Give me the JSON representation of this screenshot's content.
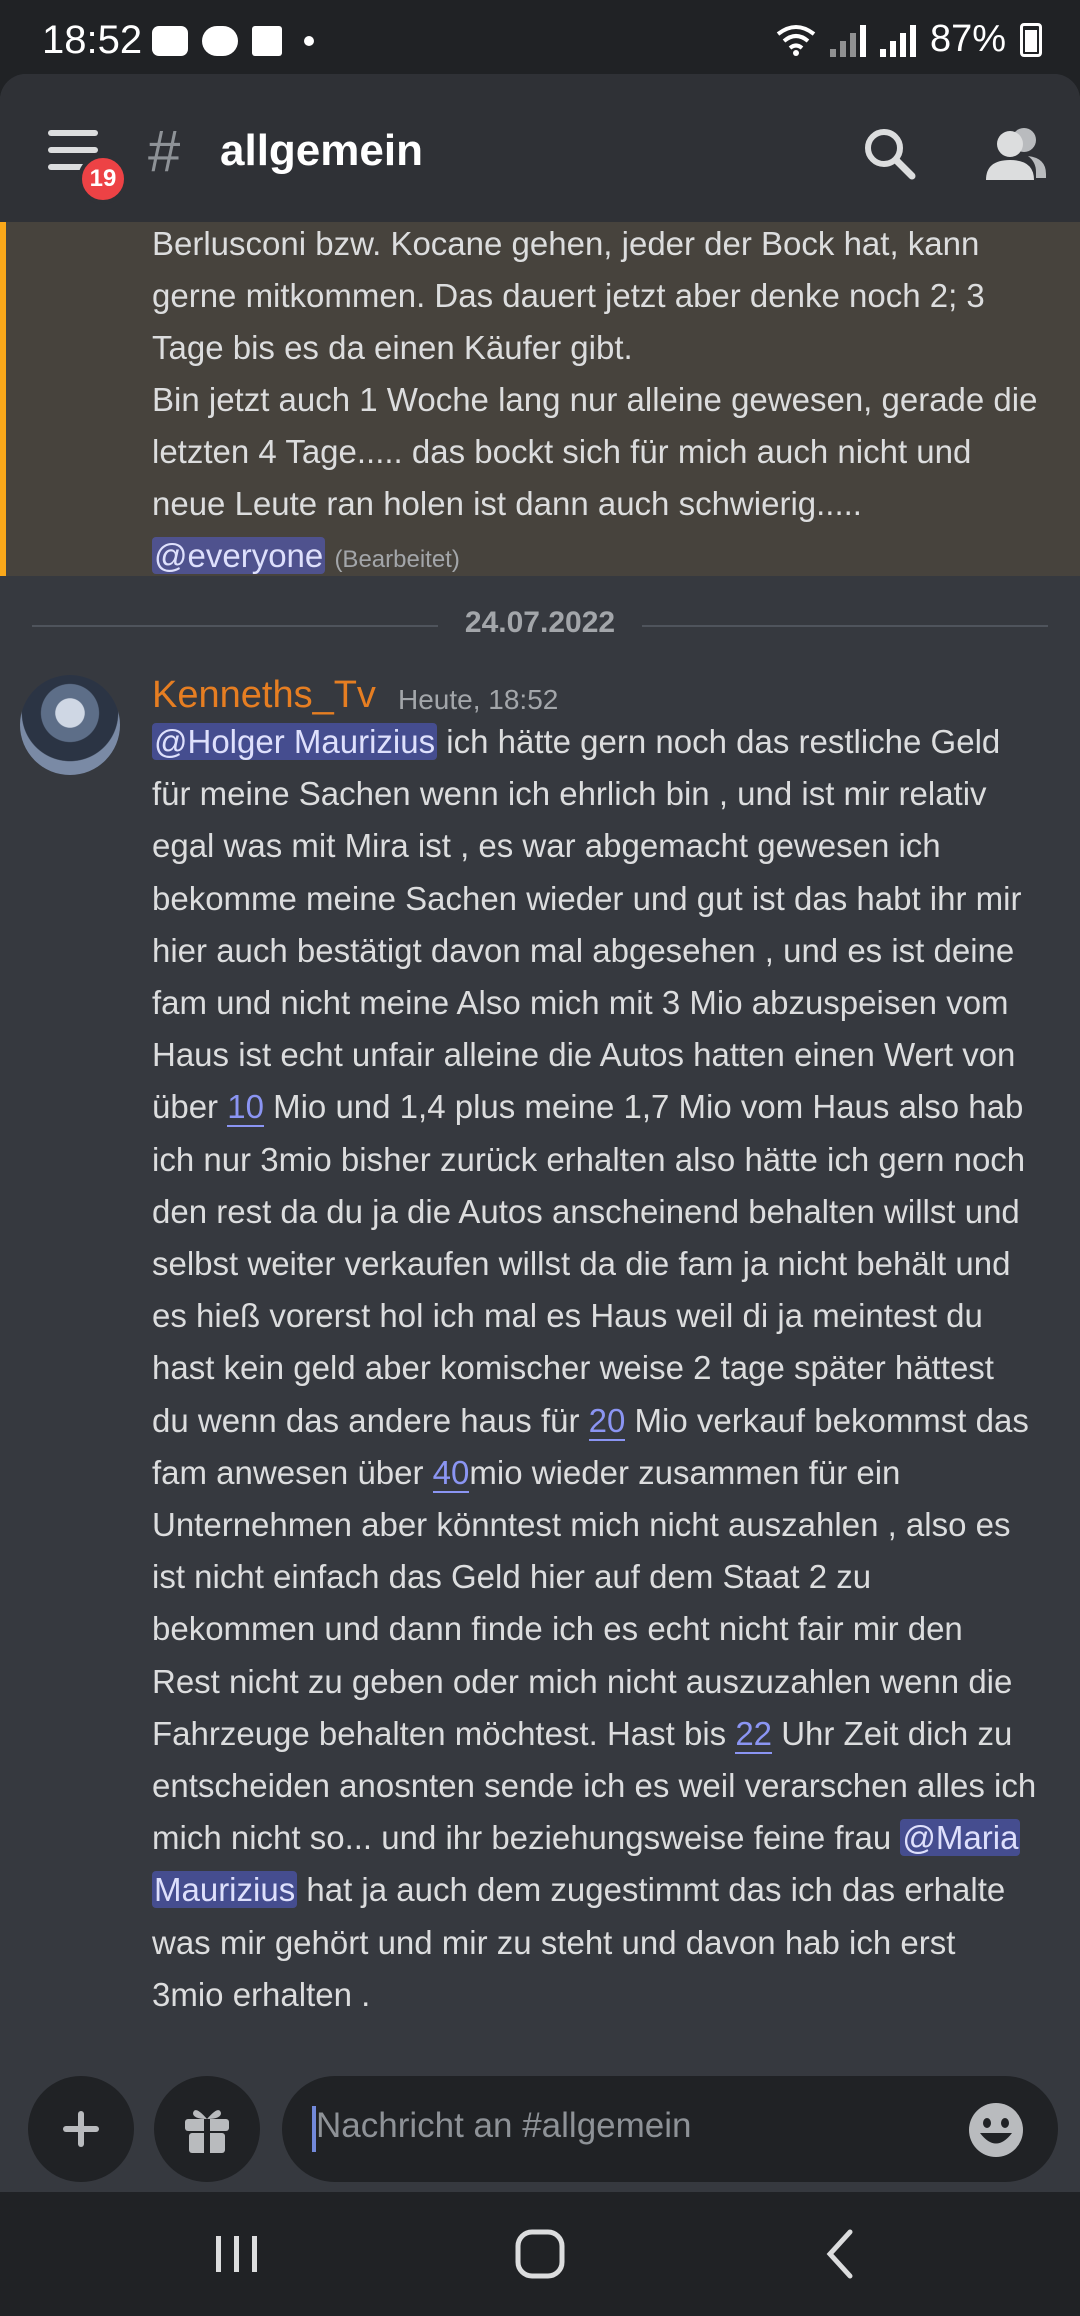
{
  "status_bar": {
    "time": "18:52",
    "battery": "87%",
    "icons_left": [
      "youtube-icon",
      "cloud-icon",
      "twitch-icon"
    ]
  },
  "header": {
    "hash": "#",
    "channel": "allgemein",
    "unread_badge": "19"
  },
  "previous_message": {
    "lines": [
      "Berlusconi bzw. Kocane gehen, jeder der Bock hat, kann",
      "gerne mitkommen. Das dauert jetzt aber denke noch 2; 3",
      "Tage bis es da einen Käufer gibt.",
      "Bin jetzt auch 1 Woche lang nur alleine gewesen, gerade die",
      "letzten 4 Tage..... das bockt sich für mich auch nicht und",
      "neue Leute ran holen ist dann auch schwierig....."
    ],
    "mention": "@everyone",
    "edited": "(Bearbeitet)"
  },
  "divider_date": "24.07.2022",
  "message": {
    "author": "Kenneths_Tv",
    "timestamp": "Heute, 18:52",
    "mention_holger": "@Holger Maurizius",
    "l1": " ich hätte gern noch das restliche Geld",
    "l2": "für meine Sachen wenn ich ehrlich bin , und ist mir relativ",
    "l3": "egal was mit Mira ist , es war abgemacht gewesen ich",
    "l4": "bekomme meine Sachen wieder und gut ist das habt ihr mir",
    "l5": "hier auch bestätigt davon mal abgesehen , und es ist deine",
    "l6": "fam und nicht meine Also mich mit 3 Mio abzuspeisen vom",
    "l7": "Haus ist echt unfair alleine die Autos hatten einen Wert von",
    "l8a": "über ",
    "n10": "10",
    "l8b": " Mio und 1,4 plus meine 1,7 Mio vom Haus also hab",
    "l9": "ich nur 3mio bisher zurück erhalten also hätte ich gern noch",
    "l10": "den rest da du ja die Autos anscheinend behalten willst und",
    "l11": "selbst weiter verkaufen willst da die fam ja nicht behält und",
    "l12": "es hieß vorerst hol ich mal es Haus weil di ja meintest du",
    "l13": "hast kein geld aber komischer weise 2 tage später hättest",
    "l14a": "du wenn das andere haus für ",
    "n20": "20",
    "l14b": " Mio verkauf bekommst das",
    "l15a": "fam anwesen über ",
    "n40": "40",
    "l15b": "mio wieder zusammen für ein",
    "l16": "Unternehmen aber könntest mich nicht auszahlen , also es",
    "l17": "ist nicht einfach das Geld hier auf dem Staat 2 zu",
    "l18": "bekommen und dann finde ich es echt nicht fair mir den",
    "l19": "Rest nicht zu geben oder mich nicht auszuzahlen wenn die",
    "l20a": "Fahrzeuge behalten möchtest.  Hast bis ",
    "n22": "22",
    "l20b": " Uhr Zeit dich zu",
    "l21": "entscheiden anosnten sende ich es weil verarschen alles ich",
    "l22a": "mich nicht so... und ihr beziehungsweise feine frau ",
    "mention_maria_1": "@Maria",
    "mention_maria_2": "Maurizius",
    "l23b": " hat ja auch dem zugestimmt das ich das erhalte",
    "l24": "was mir gehört und mir zu steht und davon hab ich erst",
    "l25": "3mio erhalten ."
  },
  "composer": {
    "placeholder": "Nachricht an #allgemein"
  },
  "colors": {
    "background": "#36393f",
    "header": "#2f3136",
    "author": "#e67e22",
    "highlight_border": "#faa81a",
    "mention_bg": "#5865f2"
  }
}
